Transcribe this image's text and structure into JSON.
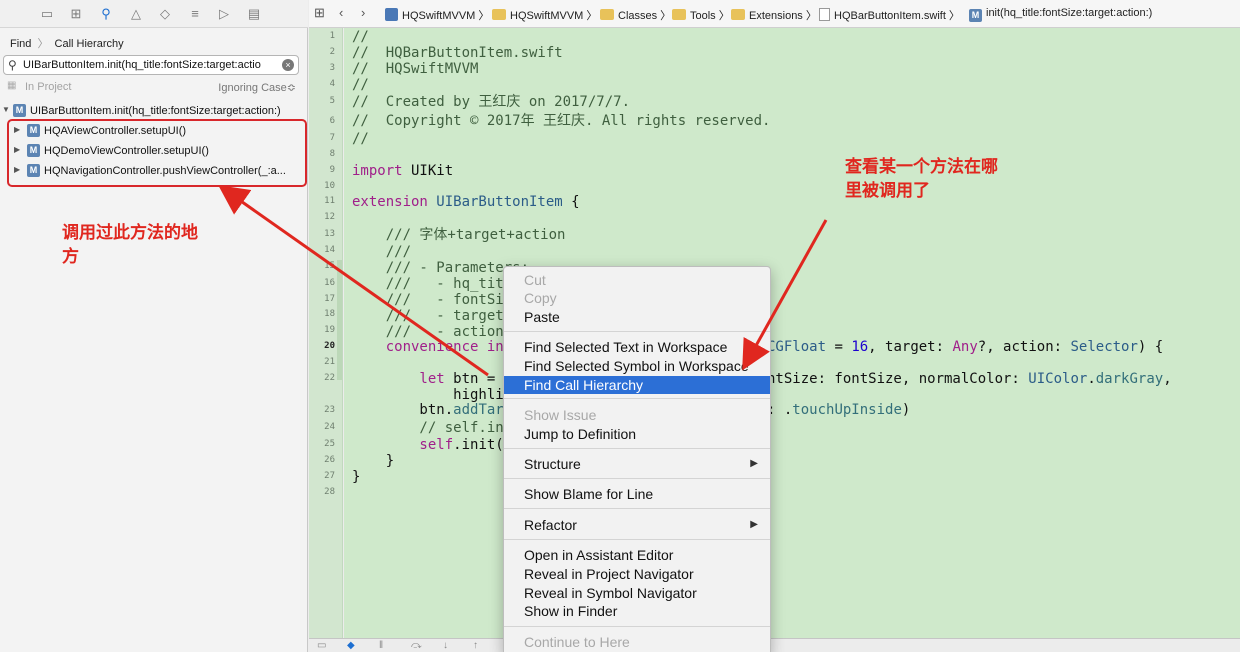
{
  "navigator": {
    "breadcrumb": {
      "find": "Find",
      "sep": "〉",
      "call_hierarchy": "Call Hierarchy"
    },
    "search": {
      "value": "UIBarButtonItem.init(hq_title:fontSize:target:actio"
    },
    "scope": {
      "left": "In Project",
      "right": "Ignoring Case≎"
    },
    "root": {
      "label": "UIBarButtonItem.init(hq_title:fontSize:target:action:)",
      "badge": "M"
    },
    "callers": [
      {
        "label": "HQAViewController.setupUI()",
        "badge": "M"
      },
      {
        "label": "HQDemoViewController.setupUI()",
        "badge": "M"
      },
      {
        "label": "HQNavigationController.pushViewController(_:a...",
        "badge": "M"
      }
    ]
  },
  "annotations": {
    "left": "调用过此方法的地方",
    "right": "查看某一个方法在哪里被调用了"
  },
  "jumpbar": {
    "items": [
      "HQSwiftMVVM",
      "HQSwiftMVVM",
      "Classes",
      "Tools",
      "Extensions",
      "HQBarButtonItem.swift",
      "init(hq_title:fontSize:target:action:)"
    ]
  },
  "code": {
    "line_numbers": [
      "1",
      "2",
      "3",
      "4",
      "5",
      "6",
      "7",
      "8",
      "9",
      "10",
      "11",
      "12",
      "13",
      "14",
      "15",
      "16",
      "17",
      "18",
      "19",
      "20",
      "21",
      "22",
      "23",
      "24",
      "25",
      "26",
      "27",
      "28"
    ],
    "lines": {
      "l1": "//",
      "l2": "//  HQBarButtonItem.swift",
      "l3": "//  HQSwiftMVVM",
      "l4": "//",
      "l5": "//  Created by 王红庆 on 2017/7/7.",
      "l6": "//  Copyright © 2017年 王红庆. All rights reserved.",
      "l7": "//",
      "l9a": "import",
      "l9b": " UIKit",
      "l11a": "extension",
      "l11b": " UIBarButtonItem",
      "l11c": " {",
      "l13": "    /// 字体+target+action",
      "l14": "    ///",
      "l15": "    /// - Parameters:",
      "l16": "    ///   - hq_title",
      "l17": "    ///   - fontSize",
      "l18": "    ///   - target",
      "l19": "    ///   - action",
      "l20a": "    convenience in",
      "l20b": "CGFloat",
      "l20c": " = ",
      "l20d": "16",
      "l20e": ", target: ",
      "l20f": "Any",
      "l20g": "?, action: ",
      "l20h": "Selector",
      "l20i": ") {",
      "l22a": "        let",
      "l22b": " btn = ",
      "l22c": "ntSize: fontSize, normalColor: ",
      "l22d": "UIColor",
      "l22e": ".",
      "l22f": "darkGray",
      "l22g": ",",
      "l22h": "            highli",
      "l23a": "        btn.",
      "l23b": "addTar",
      "l23c": ": .",
      "l23d": "touchUpInside",
      "l23e": ")",
      "l24": "        // self.in",
      "l25a": "        self",
      "l25b": ".init(",
      "l26": "    }",
      "l27": "}"
    }
  },
  "context_menu": {
    "items": [
      {
        "label": "Cut",
        "disabled": true
      },
      {
        "label": "Copy",
        "disabled": true
      },
      {
        "label": "Paste"
      },
      {
        "label": "Find Selected Text in Workspace"
      },
      {
        "label": "Find Selected Symbol in Workspace"
      },
      {
        "label": "Find Call Hierarchy",
        "selected": true
      },
      {
        "label": "Show Issue",
        "disabled": true
      },
      {
        "label": "Jump to Definition"
      },
      {
        "label": "Structure",
        "submenu": true
      },
      {
        "label": "Show Blame for Line"
      },
      {
        "label": "Refactor",
        "submenu": true
      },
      {
        "label": "Open in Assistant Editor"
      },
      {
        "label": "Reveal in Project Navigator"
      },
      {
        "label": "Reveal in Symbol Navigator"
      },
      {
        "label": "Show in Finder"
      },
      {
        "label": "Continue to Here",
        "disabled": true
      }
    ]
  },
  "colors": {
    "annotation": "#e0271f",
    "selection": "#2c6fd6",
    "editor_bg": "#cfe9cb"
  }
}
